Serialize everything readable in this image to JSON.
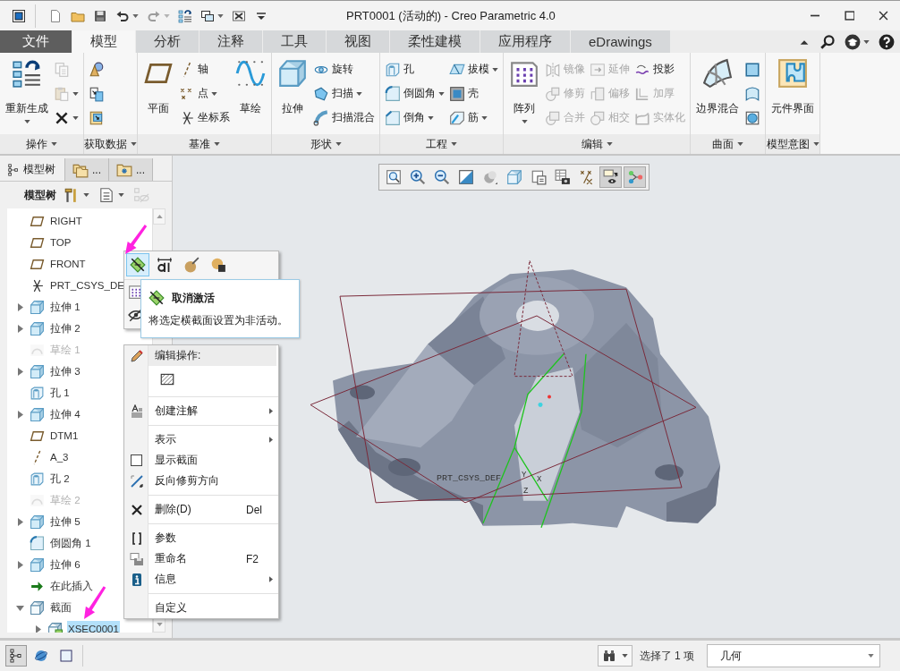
{
  "window": {
    "title": "PRT0001 (活动的) - Creo Parametric 4.0"
  },
  "quick_access": [
    {
      "kind": "app",
      "disabled": false,
      "menu": false
    },
    {
      "kind": "new",
      "disabled": false,
      "menu": false
    },
    {
      "kind": "open",
      "disabled": false,
      "menu": false
    },
    {
      "kind": "save",
      "disabled": false,
      "menu": false
    },
    {
      "kind": "undo",
      "disabled": false,
      "menu": true
    },
    {
      "kind": "redo",
      "disabled": true,
      "menu": true
    },
    {
      "kind": "regen_small",
      "disabled": false,
      "menu": false
    },
    {
      "kind": "windows",
      "disabled": false,
      "menu": true
    },
    {
      "kind": "close_win",
      "disabled": false,
      "menu": false
    },
    {
      "kind": "customize",
      "disabled": false,
      "menu": false
    }
  ],
  "ribbon_tabs": [
    {
      "label": "文件",
      "kind": "file",
      "selected": false
    },
    {
      "label": "模型",
      "kind": "tab",
      "selected": true
    },
    {
      "label": "分析",
      "kind": "tab",
      "selected": false
    },
    {
      "label": "注释",
      "kind": "tab",
      "selected": false
    },
    {
      "label": "工具",
      "kind": "tab",
      "selected": false
    },
    {
      "label": "视图",
      "kind": "tab",
      "selected": false
    },
    {
      "label": "柔性建模",
      "kind": "tab",
      "selected": false
    },
    {
      "label": "应用程序",
      "kind": "tab",
      "selected": false
    },
    {
      "label": "eDrawings",
      "kind": "tab",
      "selected": false
    }
  ],
  "ribbon_tools": [
    {
      "kind": "ribbon_up",
      "menu": false
    },
    {
      "kind": "search",
      "menu": false
    },
    {
      "kind": "community",
      "menu": true
    },
    {
      "kind": "help",
      "menu": false
    }
  ],
  "ribbon_groups": [
    {
      "label": "操作",
      "items": [
        {
          "kind": "regenerate",
          "label": "重新生成",
          "menu": true,
          "disabled": false
        },
        {
          "column": [
            {
              "kind": "copy",
              "menu": false,
              "disabled": true
            },
            {
              "kind": "paste",
              "menu": true,
              "disabled": true
            },
            {
              "kind": "delete",
              "menu": true,
              "disabled": false
            }
          ]
        }
      ]
    },
    {
      "label": "获取数据",
      "items": [
        {
          "column": [
            {
              "kind": "get_cone",
              "menu": false,
              "disabled": false
            },
            {
              "kind": "get_import",
              "menu": false,
              "disabled": false
            },
            {
              "kind": "get_import2",
              "menu": false,
              "disabled": false
            }
          ]
        }
      ]
    },
    {
      "label": "基准",
      "items": [
        {
          "kind": "plane",
          "label": "平面",
          "menu": false,
          "disabled": false
        },
        {
          "column": [
            {
              "kind": "axis",
              "label": "轴",
              "menu": false,
              "disabled": false
            },
            {
              "kind": "point",
              "label": "点",
              "menu": true,
              "disabled": false
            },
            {
              "kind": "csys",
              "label": "坐标系",
              "menu": false,
              "disabled": false
            }
          ]
        },
        {
          "kind": "sketch",
          "label": "草绘",
          "menu": false,
          "disabled": false
        }
      ]
    },
    {
      "label": "形状",
      "items": [
        {
          "kind": "extrude",
          "label": "拉伸",
          "menu": false,
          "disabled": false
        },
        {
          "column": [
            {
              "kind": "revolve",
              "label": "旋转",
              "menu": false,
              "disabled": false
            },
            {
              "kind": "sweep",
              "label": "扫描",
              "menu": true,
              "disabled": false
            },
            {
              "kind": "sweep_blend",
              "label": "扫描混合",
              "menu": false,
              "disabled": false
            }
          ]
        }
      ]
    },
    {
      "label": "工程",
      "items": [
        {
          "column": [
            {
              "kind": "hole",
              "label": "孔",
              "menu": false,
              "disabled": false
            },
            {
              "kind": "round",
              "label": "倒圆角",
              "menu": true,
              "disabled": false
            },
            {
              "kind": "chamfer",
              "label": "倒角",
              "menu": true,
              "disabled": false
            }
          ]
        },
        {
          "column": [
            {
              "kind": "draft",
              "label": "拔模",
              "menu": true,
              "disabled": false
            },
            {
              "kind": "shell",
              "label": "壳",
              "menu": false,
              "disabled": false
            },
            {
              "kind": "rib",
              "label": "筋",
              "menu": true,
              "disabled": false
            }
          ]
        }
      ]
    },
    {
      "label": "编辑",
      "items": [
        {
          "kind": "pattern",
          "label": "阵列",
          "menu": true,
          "disabled": false
        },
        {
          "column": [
            {
              "kind": "mirror",
              "label": "镜像",
              "menu": false,
              "disabled": true
            },
            {
              "kind": "trim",
              "label": "修剪",
              "menu": false,
              "disabled": true
            },
            {
              "kind": "merge",
              "label": "合并",
              "menu": false,
              "disabled": true
            }
          ]
        },
        {
          "column": [
            {
              "kind": "extend",
              "label": "延伸",
              "menu": false,
              "disabled": true
            },
            {
              "kind": "offset",
              "label": "偏移",
              "menu": false,
              "disabled": true
            },
            {
              "kind": "intersect",
              "label": "相交",
              "menu": false,
              "disabled": true
            }
          ]
        },
        {
          "column": [
            {
              "kind": "project",
              "label": "投影",
              "menu": false,
              "disabled": false
            },
            {
              "kind": "thicken",
              "label": "加厚",
              "menu": false,
              "disabled": true
            },
            {
              "kind": "solidify",
              "label": "实体化",
              "menu": false,
              "disabled": true
            }
          ]
        }
      ]
    },
    {
      "label": "曲面",
      "items": [
        {
          "kind": "boundary_blend",
          "label": "边界混合",
          "menu": false,
          "disabled": false
        },
        {
          "column": [
            {
              "kind": "fill_surf",
              "menu": false,
              "disabled": false
            },
            {
              "kind": "style_surf",
              "menu": false,
              "disabled": false
            },
            {
              "kind": "freestyle",
              "menu": false,
              "disabled": false
            }
          ]
        }
      ]
    },
    {
      "label": "模型意图",
      "items": [
        {
          "kind": "component_interface",
          "label": "元件界面",
          "menu": false,
          "disabled": false
        }
      ]
    }
  ],
  "model_tree": {
    "tabs": [
      {
        "kind": "tree",
        "label": "模型树",
        "selected": true
      },
      {
        "kind": "folders",
        "label": "...",
        "selected": false
      },
      {
        "kind": "favorites",
        "label": "...",
        "selected": false
      }
    ],
    "toolbar": {
      "label": "模型树",
      "buttons": [
        {
          "kind": "hammer",
          "menu": true,
          "disabled": false
        },
        {
          "kind": "list_settings",
          "menu": true,
          "disabled": false
        },
        {
          "kind": "tree_hide",
          "menu": false,
          "disabled": true
        }
      ]
    },
    "items": [
      {
        "label": "RIGHT",
        "kind": "plane",
        "disabled": false,
        "selected": false
      },
      {
        "label": "TOP",
        "kind": "plane",
        "disabled": false,
        "selected": false
      },
      {
        "label": "FRONT",
        "kind": "plane",
        "disabled": false,
        "selected": false
      },
      {
        "label": "PRT_CSYS_DE",
        "kind": "csys",
        "disabled": false,
        "selected": false
      },
      {
        "label": "拉伸 1",
        "kind": "extrude",
        "disabled": false,
        "selected": false,
        "expanded": false
      },
      {
        "label": "拉伸 2",
        "kind": "extrude",
        "disabled": false,
        "selected": false,
        "expanded": false
      },
      {
        "label": "草绘 1",
        "kind": "sketch_tree",
        "disabled": true,
        "selected": false
      },
      {
        "label": "拉伸 3",
        "kind": "extrude",
        "disabled": false,
        "selected": false,
        "expanded": false
      },
      {
        "label": "孔 1",
        "kind": "hole",
        "disabled": false,
        "selected": false
      },
      {
        "label": "拉伸 4",
        "kind": "extrude",
        "disabled": false,
        "selected": false,
        "expanded": false
      },
      {
        "label": "DTM1",
        "kind": "plane",
        "disabled": false,
        "selected": false
      },
      {
        "label": "A_3",
        "kind": "axis",
        "disabled": false,
        "selected": false
      },
      {
        "label": "孔 2",
        "kind": "hole",
        "disabled": false,
        "selected": false
      },
      {
        "label": "草绘 2",
        "kind": "sketch_tree",
        "disabled": true,
        "selected": false
      },
      {
        "label": "拉伸 5",
        "kind": "extrude",
        "disabled": false,
        "selected": false,
        "expanded": false
      },
      {
        "label": "倒圆角 1",
        "kind": "round",
        "disabled": false,
        "selected": false
      },
      {
        "label": "拉伸 6",
        "kind": "extrude",
        "disabled": false,
        "selected": false,
        "expanded": false
      },
      {
        "label": "在此插入",
        "kind": "insert",
        "disabled": false,
        "selected": false
      },
      {
        "label": "截面",
        "kind": "section",
        "disabled": false,
        "selected": false,
        "expanded": true,
        "children": [
          {
            "label": "XSEC0001",
            "kind": "xsec",
            "disabled": false,
            "selected": true,
            "expanded": false
          }
        ]
      }
    ]
  },
  "view_toolbar": [
    {
      "kind": "refit",
      "pressed": false
    },
    {
      "kind": "zoom_in",
      "pressed": false
    },
    {
      "kind": "zoom_out",
      "pressed": false
    },
    {
      "kind": "repaint",
      "pressed": false
    },
    {
      "kind": "shading",
      "pressed": false
    },
    {
      "kind": "saved_views",
      "pressed": false
    },
    {
      "kind": "view_manager",
      "pressed": false
    },
    {
      "kind": "camera_table",
      "pressed": false
    },
    {
      "kind": "datum_display",
      "pressed": false
    },
    {
      "kind": "annotation_display",
      "pressed": true
    },
    {
      "kind": "spin_center",
      "pressed": true
    }
  ],
  "viewport": {
    "csys_label": "PRT_CSYS_DEF",
    "axis_labels": [
      "Y",
      "Z",
      "X"
    ]
  },
  "mini_toolbar": {
    "buttons": [
      {
        "kind": "deactivate",
        "hovered": true
      },
      {
        "kind": "dimension",
        "hovered": false
      },
      {
        "kind": "appearance",
        "hovered": false
      },
      {
        "kind": "display_style",
        "hovered": false
      }
    ]
  },
  "tooltip": {
    "title": "取消激活",
    "text": "将选定横截面设置为非活动。"
  },
  "context_menu": [
    {
      "kind": "header",
      "label": "编辑操作:"
    },
    {
      "kind": "tool"
    },
    {
      "kind": "separator"
    },
    {
      "kind": "item",
      "label": "创建注解",
      "submenu": true
    },
    {
      "kind": "separator"
    },
    {
      "kind": "item",
      "label": "表示",
      "submenu": true
    },
    {
      "kind": "check",
      "label": "显示截面",
      "checked": false
    },
    {
      "kind": "item",
      "label": "反向修剪方向",
      "submenu": false
    },
    {
      "kind": "separator"
    },
    {
      "kind": "item",
      "label": "删除(D)",
      "shortcut": "Del",
      "submenu": false
    },
    {
      "kind": "separator"
    },
    {
      "kind": "item",
      "label": "参数",
      "submenu": false
    },
    {
      "kind": "item",
      "label": "重命名",
      "shortcut": "F2",
      "submenu": false
    },
    {
      "kind": "item",
      "label": "信息",
      "submenu": true
    },
    {
      "kind": "separator"
    },
    {
      "kind": "item",
      "label": "自定义",
      "submenu": false
    }
  ],
  "status_bar": {
    "buttons": [
      {
        "kind": "tree",
        "pressed": true
      },
      {
        "kind": "globe",
        "pressed": false
      },
      {
        "kind": "window_square",
        "pressed": false
      }
    ],
    "find": {
      "menu": true
    },
    "selection": "选择了 1 项",
    "filter": {
      "value": "几何"
    }
  }
}
